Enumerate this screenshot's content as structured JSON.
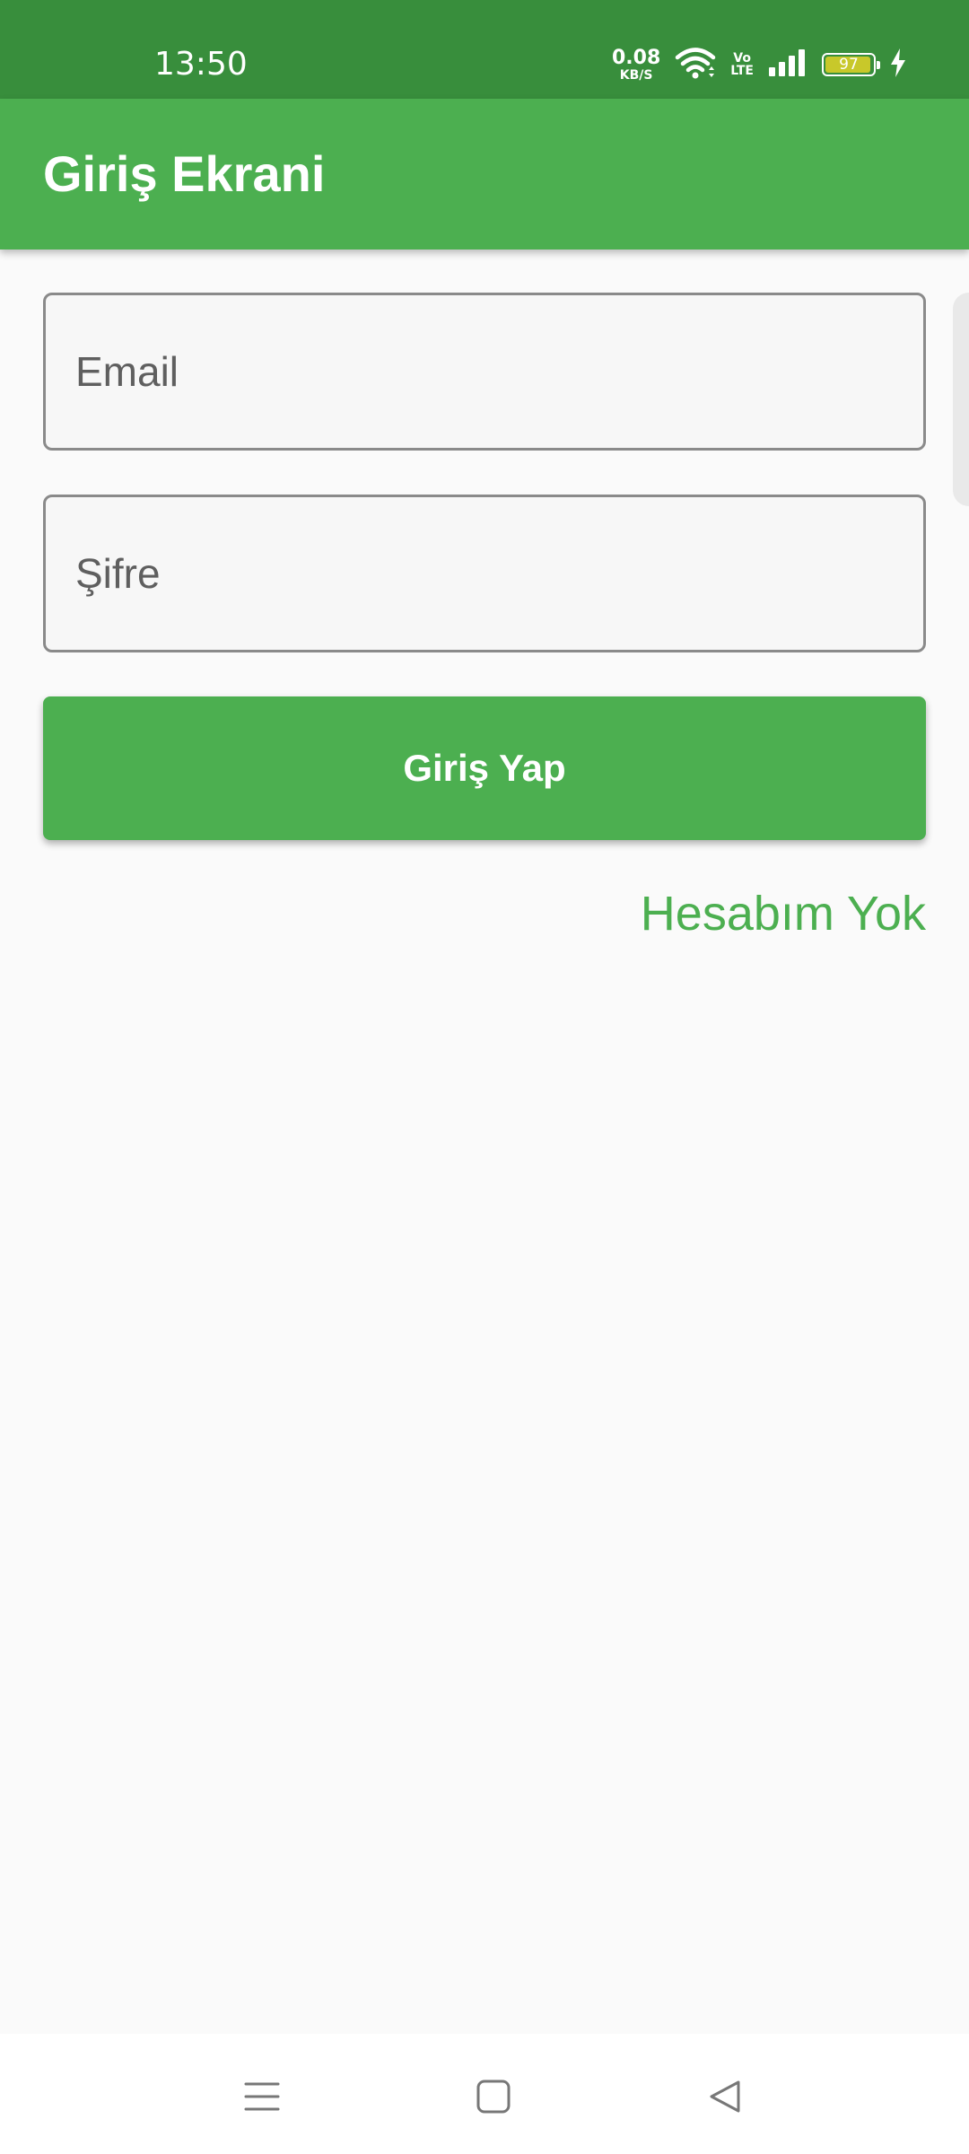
{
  "status_bar": {
    "time": "13:50",
    "net_speed_value": "0.08",
    "net_speed_unit": "KB/S",
    "volte_top": "Vo",
    "volte_bottom": "LTE",
    "battery_percent": "97",
    "battery_level": 0.97,
    "battery_color": "#c8c82a",
    "icons": [
      "wifi-icon",
      "volte-icon",
      "signal-icon",
      "battery-icon",
      "charging-icon"
    ]
  },
  "app_bar": {
    "title": "Giriş Ekrani",
    "color": "#4caf50"
  },
  "form": {
    "email": {
      "placeholder": "Email",
      "value": ""
    },
    "password": {
      "placeholder": "Şifre",
      "value": ""
    },
    "login_button": "Giriş Yap",
    "no_account_link": "Hesabım Yok"
  },
  "colors": {
    "status_bar": "#388e3c",
    "accent": "#4caf50",
    "background": "#fafafa"
  },
  "nav_bar": {
    "icons": [
      "menu-icon",
      "home-square-icon",
      "back-triangle-icon"
    ]
  }
}
